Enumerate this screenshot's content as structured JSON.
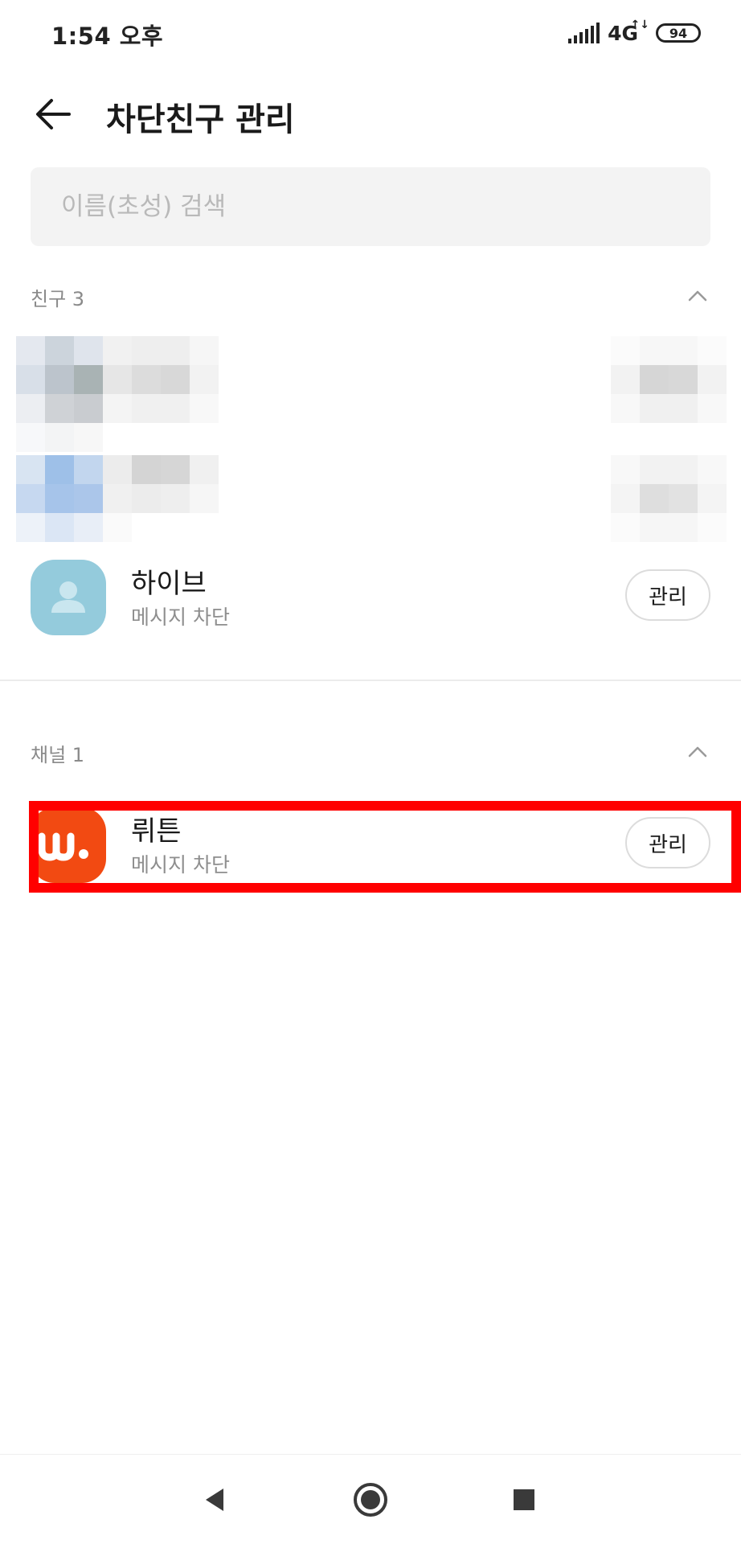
{
  "status_bar": {
    "time": "1:54 오후",
    "network": "4G",
    "network_arrows": "↑↓",
    "battery": "94"
  },
  "app_bar": {
    "title": "차단친구 관리"
  },
  "search": {
    "placeholder": "이름(초성) 검색"
  },
  "sections": {
    "friends": {
      "label": "친구 3",
      "items": [
        {
          "name": "하이브",
          "status": "메시지 차단",
          "action_label": "관리",
          "avatar_icon": "person-icon"
        }
      ]
    },
    "channels": {
      "label": "채널 1",
      "items": [
        {
          "name": "뤼튼",
          "status": "메시지 차단",
          "action_label": "관리",
          "avatar_icon": "wrtn-logo"
        }
      ]
    }
  },
  "colors": {
    "avatar_default": "#94cbdc",
    "brand_orange": "#f24a12",
    "highlight": "#ff0000"
  }
}
